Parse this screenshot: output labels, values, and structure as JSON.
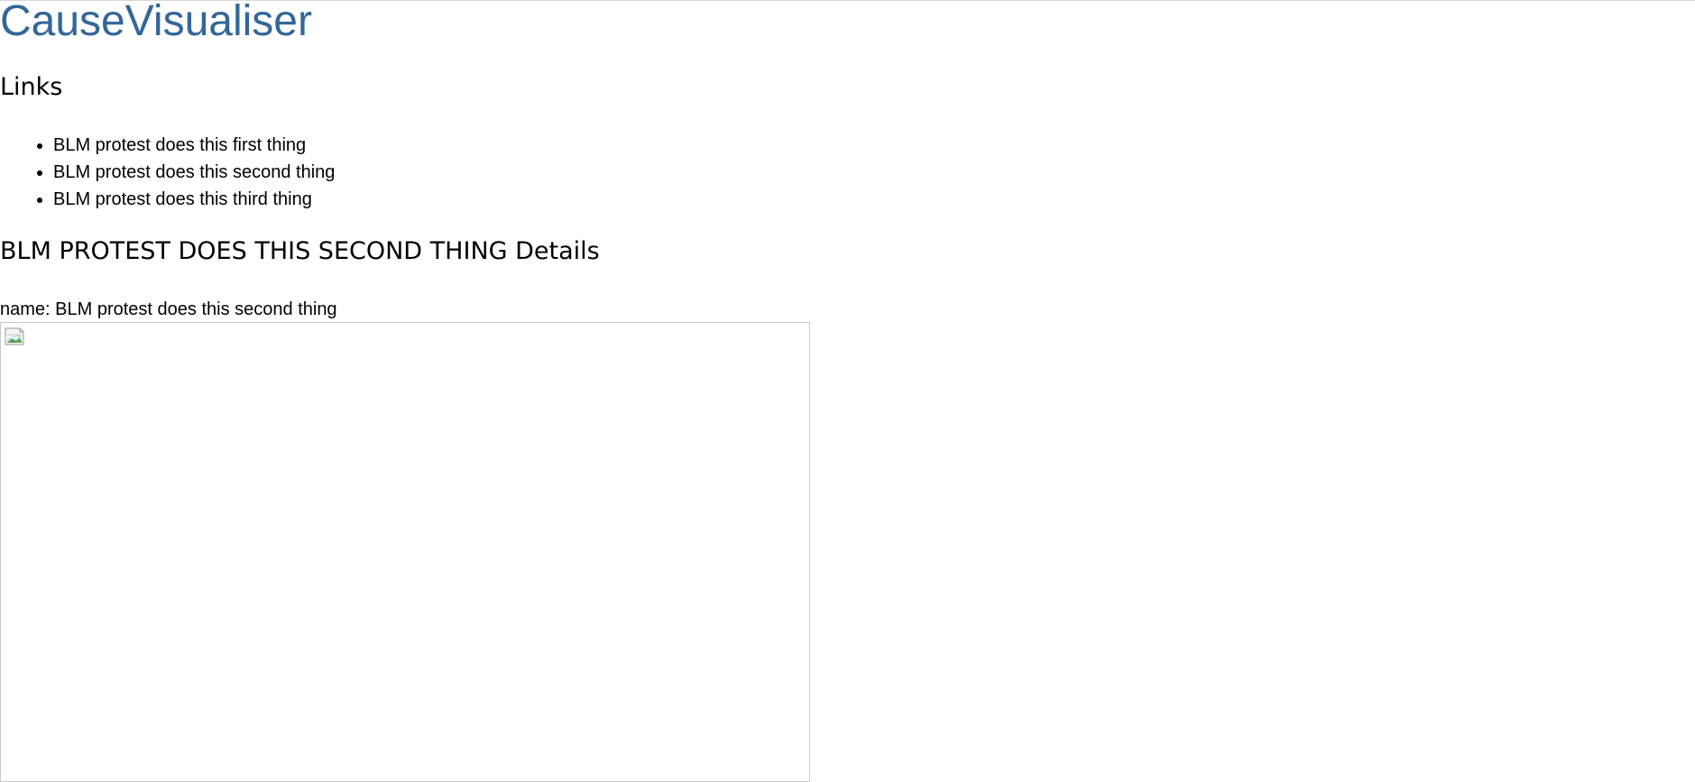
{
  "app": {
    "title": "CauseVisualiser"
  },
  "links": {
    "heading": "Links",
    "items": [
      {
        "label": "BLM protest does this first thing"
      },
      {
        "label": "BLM protest does this second thing"
      },
      {
        "label": "BLM protest does this third thing"
      }
    ]
  },
  "details": {
    "heading": "BLM PROTEST DOES THIS SECOND THING Details",
    "name_label": "name:",
    "name_value": "BLM protest does this second thing"
  },
  "image": {
    "icon": "broken-image-icon"
  },
  "colors": {
    "title": "#336699",
    "text": "#000000",
    "border": "#c9c9c9"
  }
}
